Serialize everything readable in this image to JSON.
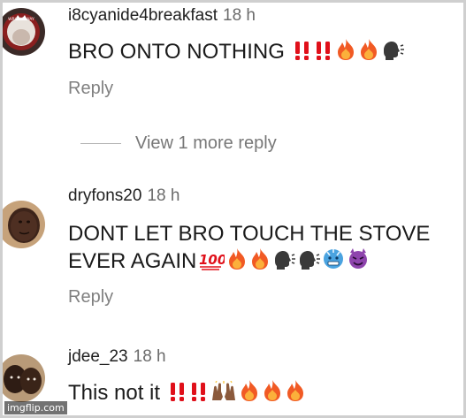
{
  "comments": [
    {
      "username": "i8cyanide4breakfast",
      "time": "18 h",
      "text": "BRO ONTO  NOTHING",
      "emojis": [
        "double-exclamation",
        "double-exclamation",
        "fire",
        "fire",
        "speaking-head"
      ],
      "reply_label": "Reply",
      "avatar_text": "WRONG WAY"
    },
    {
      "username": "dryfons20",
      "time": "18 h",
      "text_line1": "DONT LET BRO TOUCH THE STOVE",
      "text_line2": "EVER AGAIN",
      "emojis": [
        "hundred",
        "fire",
        "fire",
        "speaking-head",
        "speaking-head",
        "cold-face",
        "smiling-imp"
      ],
      "reply_label": "Reply"
    },
    {
      "username": "jdee_23",
      "time": "18 h",
      "text": "This not it",
      "emojis": [
        "double-exclamation",
        "double-exclamation",
        "raised-hands",
        "fire",
        "fire",
        "fire"
      ]
    }
  ],
  "view_more": {
    "label": "View 1 more reply"
  },
  "watermark": {
    "text": "imgflip.com"
  },
  "colors": {
    "fire": "#f15a24",
    "exclamation": "#e0101a",
    "cold": "#4aa3e0",
    "imp": "#8e44ad"
  }
}
